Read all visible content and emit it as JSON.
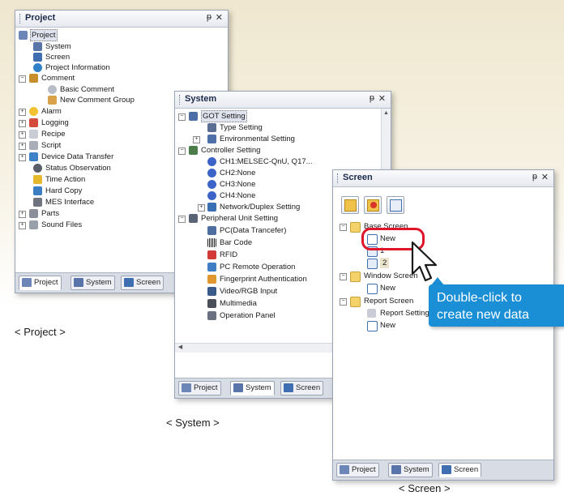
{
  "colors": {
    "accent_blue": "#1a8fd6",
    "highlight_red": "#e0142b"
  },
  "project_panel": {
    "title": "Project",
    "pin": "ᵽ",
    "close": "✕",
    "caption": "< Project >",
    "items": [
      {
        "label": "Project",
        "icon": "project-icon"
      },
      {
        "label": "System",
        "icon": "system-icon"
      },
      {
        "label": "Screen",
        "icon": "screen-icon"
      },
      {
        "label": "Project Information",
        "icon": "info-icon"
      },
      {
        "label": "Comment",
        "icon": "comment-icon"
      },
      {
        "label": "Basic Comment",
        "icon": "basic-comment-icon"
      },
      {
        "label": "New Comment Group",
        "icon": "new-comment-group-icon"
      },
      {
        "label": "Alarm",
        "icon": "alarm-icon"
      },
      {
        "label": "Logging",
        "icon": "logging-icon"
      },
      {
        "label": "Recipe",
        "icon": "recipe-icon"
      },
      {
        "label": "Script",
        "icon": "script-icon"
      },
      {
        "label": "Device Data Transfer",
        "icon": "device-data-transfer-icon"
      },
      {
        "label": "Status Observation",
        "icon": "status-observation-icon"
      },
      {
        "label": "Time Action",
        "icon": "time-action-icon"
      },
      {
        "label": "Hard Copy",
        "icon": "hard-copy-icon"
      },
      {
        "label": "MES Interface",
        "icon": "mes-interface-icon"
      },
      {
        "label": "Parts",
        "icon": "parts-icon"
      },
      {
        "label": "Sound Files",
        "icon": "sound-files-icon"
      }
    ],
    "tabs": [
      "Project",
      "System",
      "Screen"
    ]
  },
  "system_panel": {
    "title": "System",
    "pin": "ᵽ",
    "close": "✕",
    "caption": "< System >",
    "items": [
      {
        "label": "GOT Setting",
        "icon": "got-setting-icon"
      },
      {
        "label": "Type Setting",
        "icon": "type-setting-icon"
      },
      {
        "label": "Environmental Setting",
        "icon": "environmental-setting-icon"
      },
      {
        "label": "Controller Setting",
        "icon": "controller-setting-icon"
      },
      {
        "label": "CH1:MELSEC-QnU, Q17...",
        "icon": "channel-icon"
      },
      {
        "label": "CH2:None",
        "icon": "channel-icon"
      },
      {
        "label": "CH3:None",
        "icon": "channel-icon"
      },
      {
        "label": "CH4:None",
        "icon": "channel-icon"
      },
      {
        "label": "Network/Duplex Setting",
        "icon": "network-icon"
      },
      {
        "label": "Peripheral Unit Setting",
        "icon": "peripheral-icon"
      },
      {
        "label": "PC(Data Trancefer)",
        "icon": "pc-icon"
      },
      {
        "label": "Bar Code",
        "icon": "barcode-icon"
      },
      {
        "label": "RFID",
        "icon": "rfid-icon"
      },
      {
        "label": "PC Remote Operation",
        "icon": "pc-remote-icon"
      },
      {
        "label": "Fingerprint Authentication",
        "icon": "fingerprint-icon"
      },
      {
        "label": "Video/RGB Input",
        "icon": "video-icon"
      },
      {
        "label": "Multimedia",
        "icon": "multimedia-icon"
      },
      {
        "label": "Operation Panel",
        "icon": "operation-panel-icon"
      }
    ],
    "tabs": [
      "Project",
      "System",
      "Screen"
    ]
  },
  "screen_panel": {
    "title": "Screen",
    "pin": "ᵽ",
    "close": "✕",
    "caption": "< Screen >",
    "toolbar": [
      "new-screen-icon",
      "delete-screen-icon",
      "properties-icon"
    ],
    "items": [
      {
        "label": "Base Screen",
        "icon": "folder-icon"
      },
      {
        "label": "New",
        "icon": "new-screen-icon"
      },
      {
        "label": "1",
        "icon": "screen-page-icon"
      },
      {
        "label": "2",
        "icon": "screen-page-icon"
      },
      {
        "label": "Window Screen",
        "icon": "folder-icon"
      },
      {
        "label": "New",
        "icon": "new-screen-icon"
      },
      {
        "label": "Report Screen",
        "icon": "folder-icon"
      },
      {
        "label": "Report Setting",
        "icon": "report-setting-icon"
      },
      {
        "label": "New",
        "icon": "new-screen-icon"
      }
    ],
    "tabs": [
      "Project",
      "System",
      "Screen"
    ]
  },
  "callout": {
    "line1": "Double-click to",
    "line2": "create new data"
  }
}
